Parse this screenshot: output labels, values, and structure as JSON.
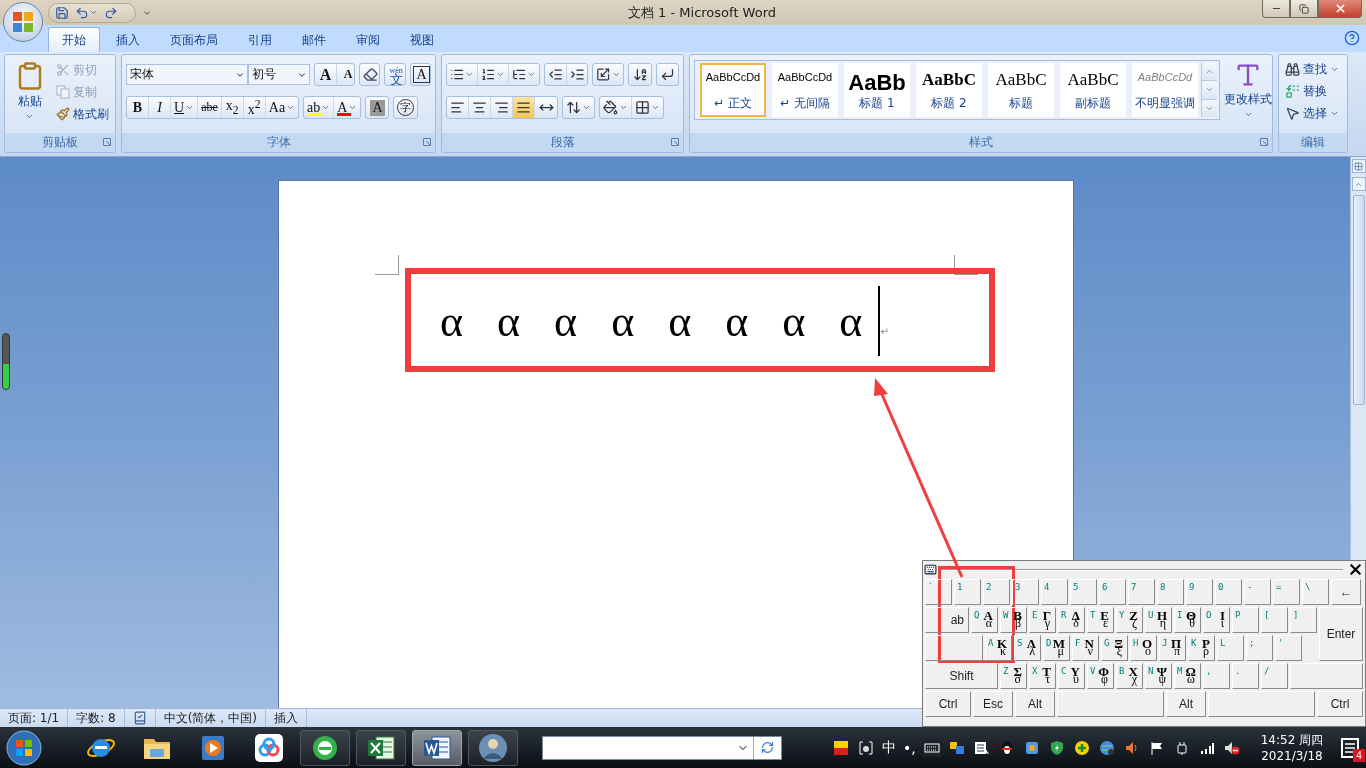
{
  "title_bar": {
    "title": "文档 1 - Microsoft Word"
  },
  "tabs": [
    {
      "label": "开始",
      "selected": true
    },
    {
      "label": "插入",
      "selected": false
    },
    {
      "label": "页面布局",
      "selected": false
    },
    {
      "label": "引用",
      "selected": false
    },
    {
      "label": "邮件",
      "selected": false
    },
    {
      "label": "审阅",
      "selected": false
    },
    {
      "label": "视图",
      "selected": false
    }
  ],
  "ribbon": {
    "clipboard": {
      "paste": "粘贴",
      "items": [
        {
          "kind": "cut",
          "label": "剪切",
          "disabled": true
        },
        {
          "kind": "copy",
          "label": "复制",
          "disabled": true
        },
        {
          "kind": "brush",
          "label": "格式刷",
          "disabled": false
        }
      ],
      "group_label": "剪贴板"
    },
    "font": {
      "font_name": "宋体",
      "font_size": "初号",
      "top_buttons": [
        {
          "kind": "grow",
          "label": "A"
        },
        {
          "kind": "shrink",
          "label": "A"
        },
        {
          "kind": "clear"
        },
        {
          "kind": "phonetic",
          "label": "文",
          "ruby": "wén"
        },
        {
          "kind": "border",
          "label": "A"
        }
      ],
      "format_buttons": [
        {
          "kind": "bold",
          "label": "B",
          "dropdown": false
        },
        {
          "kind": "italic",
          "label": "I",
          "dropdown": false
        },
        {
          "kind": "underline",
          "label": "U",
          "dropdown": true
        },
        {
          "kind": "strike",
          "label": "abe",
          "dropdown": false
        },
        {
          "kind": "subscript",
          "label": "x$_{2}$",
          "dropdown": false
        },
        {
          "kind": "superscript",
          "label": "x$^{2}$",
          "dropdown": false
        },
        {
          "kind": "case",
          "label": "Aa",
          "dropdown": true
        }
      ],
      "color_buttons": [
        {
          "kind": "highlight",
          "label": "ab",
          "color": "#ffff00",
          "dropdown": true
        },
        {
          "kind": "font-color",
          "label": "A",
          "color": "#ff0000",
          "dropdown": true
        },
        {
          "kind": "shading",
          "label": "A",
          "dropdown": false
        },
        {
          "kind": "enclose",
          "label": "字",
          "dropdown": false
        }
      ],
      "group_label": "字体"
    },
    "paragraph": {
      "buttons": [
        {
          "kind": "bullets",
          "dropdown": true,
          "selected": false
        },
        {
          "kind": "numbering",
          "dropdown": true,
          "selected": false
        },
        {
          "kind": "multilevel",
          "dropdown": true,
          "selected": false
        },
        {
          "kind": "outdent",
          "dropdown": false,
          "selected": false
        },
        {
          "kind": "indent",
          "dropdown": false,
          "selected": false
        },
        {
          "kind": "asian-layout",
          "dropdown": true,
          "selected": false
        },
        {
          "kind": "sort",
          "dropdown": false,
          "selected": false
        },
        {
          "kind": "show-marks",
          "dropdown": false,
          "selected": false
        },
        {
          "kind": "align-left",
          "dropdown": false,
          "selected": false
        },
        {
          "kind": "align-center",
          "dropdown": false,
          "selected": false
        },
        {
          "kind": "align-right",
          "dropdown": false,
          "selected": false
        },
        {
          "kind": "justify",
          "dropdown": false,
          "selected": true
        },
        {
          "kind": "distribute",
          "dropdown": false,
          "selected": false
        },
        {
          "kind": "line-spacing",
          "dropdown": true,
          "selected": false
        },
        {
          "kind": "shading",
          "dropdown": true,
          "selected": false
        },
        {
          "kind": "borders",
          "dropdown": true,
          "selected": false
        }
      ],
      "group_label": "段落"
    },
    "styles": {
      "items": [
        {
          "kind": "normal",
          "preview": "AaBbCcDd",
          "name": "↵ 正文",
          "selected": true
        },
        {
          "kind": "normal",
          "preview": "AaBbCcDd",
          "name": "↵ 无间隔",
          "selected": false
        },
        {
          "kind": "heading1",
          "preview": "AaBb",
          "name": "标题 1",
          "selected": false
        },
        {
          "kind": "heading2",
          "preview": "AaBbC",
          "name": "标题 2",
          "selected": false
        },
        {
          "kind": "title",
          "preview": "AaBbC",
          "name": "标题",
          "selected": false
        },
        {
          "kind": "title",
          "preview": "AaBbC",
          "name": "副标题",
          "selected": false
        },
        {
          "kind": "subtle",
          "preview": "AaBbCcDd",
          "name": "不明显强调",
          "selected": false
        }
      ],
      "change_styles": "更改样式",
      "group_label": "样式"
    },
    "editing": {
      "items": [
        {
          "kind": "find",
          "label": "查找",
          "dropdown": true
        },
        {
          "kind": "replace",
          "label": "替换",
          "dropdown": false
        },
        {
          "kind": "select",
          "label": "选择",
          "dropdown": true
        }
      ],
      "group_label": "编辑"
    }
  },
  "document": {
    "text": "α α α α α α α α",
    "end_mark": "↵"
  },
  "status_bar": [
    {
      "kind": "text",
      "label": "页面: 1/1"
    },
    {
      "kind": "text",
      "label": "字数: 8"
    },
    {
      "kind": "proofing"
    },
    {
      "kind": "text",
      "label": "中文(简体，中国)"
    },
    {
      "kind": "text",
      "label": "插入"
    }
  ],
  "soft_keyboard": {
    "rows": [
      {
        "keys": [
          {
            "kind": "char",
            "latin": "`"
          },
          {
            "kind": "char",
            "latin": "1"
          },
          {
            "kind": "char",
            "latin": "2"
          },
          {
            "kind": "char",
            "latin": "3"
          },
          {
            "kind": "char",
            "latin": "4"
          },
          {
            "kind": "char",
            "latin": "5"
          },
          {
            "kind": "char",
            "latin": "6"
          },
          {
            "kind": "char",
            "latin": "7"
          },
          {
            "kind": "char",
            "latin": "8"
          },
          {
            "kind": "char",
            "latin": "9"
          },
          {
            "kind": "char",
            "latin": "0"
          },
          {
            "kind": "char",
            "latin": "-"
          },
          {
            "kind": "char",
            "latin": "="
          },
          {
            "kind": "char",
            "latin": "\\"
          },
          {
            "kind": "backspace",
            "label": "←"
          }
        ]
      },
      {
        "keys": [
          {
            "kind": "tab",
            "label": "ab"
          },
          {
            "kind": "char",
            "latin": "Q",
            "upper": "Α",
            "lower": "α"
          },
          {
            "kind": "char",
            "latin": "W",
            "upper": "Β",
            "lower": "β"
          },
          {
            "kind": "char",
            "latin": "E",
            "upper": "Γ",
            "lower": "γ"
          },
          {
            "kind": "char",
            "latin": "R",
            "upper": "Δ",
            "lower": "δ"
          },
          {
            "kind": "char",
            "latin": "T",
            "upper": "Ε",
            "lower": "ε"
          },
          {
            "kind": "char",
            "latin": "Y",
            "upper": "Ζ",
            "lower": "ζ"
          },
          {
            "kind": "char",
            "latin": "U",
            "upper": "Η",
            "lower": "η"
          },
          {
            "kind": "char",
            "latin": "I",
            "upper": "Θ",
            "lower": "θ"
          },
          {
            "kind": "char",
            "latin": "O",
            "upper": "Ι",
            "lower": "ι"
          },
          {
            "kind": "char",
            "latin": "P"
          },
          {
            "kind": "char",
            "latin": "["
          },
          {
            "kind": "char",
            "latin": "]"
          }
        ]
      },
      {
        "keys": [
          {
            "kind": "caps"
          },
          {
            "kind": "char",
            "latin": "A",
            "upper": "Κ",
            "lower": "κ"
          },
          {
            "kind": "char",
            "latin": "S",
            "upper": "Λ",
            "lower": "λ"
          },
          {
            "kind": "char",
            "latin": "D",
            "upper": "Μ",
            "lower": "μ"
          },
          {
            "kind": "char",
            "latin": "F",
            "upper": "Ν",
            "lower": "ν"
          },
          {
            "kind": "char",
            "latin": "G",
            "upper": "Ξ",
            "lower": "ξ"
          },
          {
            "kind": "char",
            "latin": "H",
            "upper": "Ο",
            "lower": "ο"
          },
          {
            "kind": "char",
            "latin": "J",
            "upper": "Π",
            "lower": "π"
          },
          {
            "kind": "char",
            "latin": "K",
            "upper": "Ρ",
            "lower": "ρ"
          },
          {
            "kind": "char",
            "latin": "L"
          },
          {
            "kind": "char",
            "latin": ";"
          },
          {
            "kind": "char",
            "latin": "'"
          }
        ]
      },
      {
        "keys": [
          {
            "kind": "shift",
            "label": "Shift"
          },
          {
            "kind": "char",
            "latin": "Z",
            "upper": "Σ",
            "lower": "σ"
          },
          {
            "kind": "char",
            "latin": "X",
            "upper": "Τ",
            "lower": "τ"
          },
          {
            "kind": "char",
            "latin": "C",
            "upper": "Υ",
            "lower": "υ"
          },
          {
            "kind": "char",
            "latin": "V",
            "upper": "Φ",
            "lower": "φ"
          },
          {
            "kind": "char",
            "latin": "B",
            "upper": "Χ",
            "lower": "χ"
          },
          {
            "kind": "char",
            "latin": "N",
            "upper": "Ψ",
            "lower": "ψ"
          },
          {
            "kind": "char",
            "latin": "M",
            "upper": "Ω",
            "lower": "ω"
          },
          {
            "kind": "char",
            "latin": ","
          },
          {
            "kind": "char",
            "latin": "."
          },
          {
            "kind": "char",
            "latin": "/"
          },
          {
            "kind": "blank"
          }
        ]
      },
      {
        "keys": [
          {
            "kind": "ctrl",
            "label": "Ctrl"
          },
          {
            "kind": "esc",
            "label": "Esc"
          },
          {
            "kind": "alt",
            "label": "Alt"
          },
          {
            "kind": "space"
          },
          {
            "kind": "alt",
            "label": "Alt"
          },
          {
            "kind": "blank"
          },
          {
            "kind": "ctrl",
            "label": "Ctrl"
          }
        ]
      }
    ],
    "enter": "Enter"
  },
  "taskbar": {
    "apps": [
      {
        "kind": "ie",
        "running": false,
        "selected": false
      },
      {
        "kind": "folder",
        "running": false,
        "selected": false
      },
      {
        "kind": "media",
        "running": false,
        "selected": false
      },
      {
        "kind": "cloud",
        "running": false,
        "selected": false
      },
      {
        "kind": "browser",
        "running": true,
        "selected": false
      },
      {
        "kind": "excel",
        "running": true,
        "selected": false
      },
      {
        "kind": "word",
        "running": true,
        "selected": true
      },
      {
        "kind": "avatar",
        "running": true,
        "selected": false
      }
    ],
    "tray": [
      {
        "kind": "ime-logo"
      },
      {
        "kind": "ime-mode"
      },
      {
        "kind": "text",
        "label": "中"
      },
      {
        "kind": "text",
        "label": "•,"
      },
      {
        "kind": "soft-keyboard"
      },
      {
        "kind": "ime-tools"
      },
      {
        "kind": "ime-menu"
      },
      {
        "kind": "penguin"
      },
      {
        "kind": "app"
      },
      {
        "kind": "shield"
      },
      {
        "kind": "plus"
      },
      {
        "kind": "globe"
      },
      {
        "kind": "speaker"
      },
      {
        "kind": "flag"
      },
      {
        "kind": "plug"
      },
      {
        "kind": "signal"
      },
      {
        "kind": "muted"
      }
    ],
    "time": "14:52 周四",
    "date": "2021/3/18",
    "badge": "4"
  }
}
